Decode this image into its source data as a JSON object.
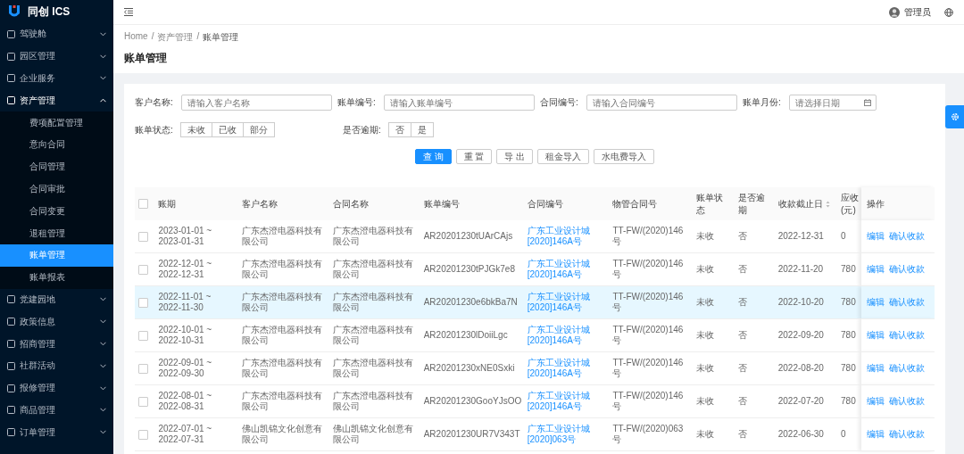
{
  "sidebar": {
    "logo": "同创 ICS",
    "items": [
      {
        "label": "驾驶舱",
        "expanded": false
      },
      {
        "label": "园区管理",
        "expanded": false
      },
      {
        "label": "企业服务",
        "expanded": false
      },
      {
        "label": "资产管理",
        "expanded": true,
        "children": [
          {
            "label": "费项配置管理",
            "selected": false
          },
          {
            "label": "意向合同",
            "selected": false
          },
          {
            "label": "合同管理",
            "selected": false
          },
          {
            "label": "合同审批",
            "selected": false
          },
          {
            "label": "合同变更",
            "selected": false
          },
          {
            "label": "退租管理",
            "selected": false
          },
          {
            "label": "账单管理",
            "selected": true
          },
          {
            "label": "账单报表",
            "selected": false
          }
        ]
      },
      {
        "label": "党建园地",
        "expanded": false
      },
      {
        "label": "政策信息",
        "expanded": false
      },
      {
        "label": "招商管理",
        "expanded": false
      },
      {
        "label": "社群活动",
        "expanded": false
      },
      {
        "label": "报修管理",
        "expanded": false
      },
      {
        "label": "商品管理",
        "expanded": false
      },
      {
        "label": "订单管理",
        "expanded": false
      }
    ]
  },
  "header": {
    "user": "管理员"
  },
  "breadcrumb": {
    "separator": "/",
    "items": [
      "Home",
      "资产管理",
      "账单管理"
    ]
  },
  "page_title": "账单管理",
  "filters": {
    "fields": [
      {
        "label": "客户名称:",
        "placeholder": "请输入客户名称",
        "kind": "text"
      },
      {
        "label": "账单编号:",
        "placeholder": "请输入账单编号",
        "kind": "text"
      },
      {
        "label": "合同编号:",
        "placeholder": "请输入合同编号",
        "kind": "text"
      },
      {
        "label": "账单月份:",
        "placeholder": "请选择日期",
        "kind": "date"
      }
    ],
    "groups": [
      {
        "label": "账单状态:",
        "options": [
          {
            "label": "未收",
            "selected": false
          },
          {
            "label": "已收",
            "selected": false
          },
          {
            "label": "部分",
            "selected": false
          }
        ]
      },
      {
        "label": "是否逾期:",
        "options": [
          {
            "label": "否",
            "selected": false
          },
          {
            "label": "是",
            "selected": false
          }
        ]
      }
    ],
    "buttons": [
      {
        "label": "查 询",
        "kind": "primary"
      },
      {
        "label": "重 置",
        "kind": "default"
      },
      {
        "label": "导 出",
        "kind": "default"
      },
      {
        "label": "租金导入",
        "kind": "default"
      },
      {
        "label": "水电费导入",
        "kind": "default"
      }
    ]
  },
  "table": {
    "all_checked": false,
    "columns": [
      "账期",
      "客户名称",
      "合同名称",
      "账单编号",
      "合同编号",
      "物管合同号",
      "账单状态",
      "是否逾期",
      "收款截止日",
      "应收(元)",
      "操作"
    ],
    "rows": [
      {
        "checked": false,
        "hovered": false,
        "cells": [
          "2023-01-01 ~ 2023-01-31",
          "广东杰澄电器科技有限公司",
          "广东杰澄电器科技有限公司",
          "AR20201230tUArCAjs",
          "广东工业设计城[2020]146A号",
          "TT-FW/(2020)146号",
          "未收",
          "否",
          "2022-12-31",
          "0"
        ],
        "actions": [
          "编辑",
          "确认收款"
        ]
      },
      {
        "checked": false,
        "hovered": false,
        "cells": [
          "2022-12-01 ~ 2022-12-31",
          "广东杰澄电器科技有限公司",
          "广东杰澄电器科技有限公司",
          "AR20201230tPJGk7e8",
          "广东工业设计城[2020]146A号",
          "TT-FW/(2020)146号",
          "未收",
          "否",
          "2022-11-20",
          "780"
        ],
        "actions": [
          "编辑",
          "确认收款"
        ]
      },
      {
        "checked": false,
        "hovered": true,
        "cells": [
          "2022-11-01 ~ 2022-11-30",
          "广东杰澄电器科技有限公司",
          "广东杰澄电器科技有限公司",
          "AR20201230e6bkBa7N",
          "广东工业设计城[2020]146A号",
          "TT-FW/(2020)146号",
          "未收",
          "否",
          "2022-10-20",
          "780"
        ],
        "actions": [
          "编辑",
          "确认收款"
        ]
      },
      {
        "checked": false,
        "hovered": false,
        "cells": [
          "2022-10-01 ~ 2022-10-31",
          "广东杰澄电器科技有限公司",
          "广东杰澄电器科技有限公司",
          "AR20201230lDoiiLgc",
          "广东工业设计城[2020]146A号",
          "TT-FW/(2020)146号",
          "未收",
          "否",
          "2022-09-20",
          "780"
        ],
        "actions": [
          "编辑",
          "确认收款"
        ]
      },
      {
        "checked": false,
        "hovered": false,
        "cells": [
          "2022-09-01 ~ 2022-09-30",
          "广东杰澄电器科技有限公司",
          "广东杰澄电器科技有限公司",
          "AR20201230xNE0Sxki",
          "广东工业设计城[2020]146A号",
          "TT-FW/(2020)146号",
          "未收",
          "否",
          "2022-08-20",
          "780"
        ],
        "actions": [
          "编辑",
          "确认收款"
        ]
      },
      {
        "checked": false,
        "hovered": false,
        "cells": [
          "2022-08-01 ~ 2022-08-31",
          "广东杰澄电器科技有限公司",
          "广东杰澄电器科技有限公司",
          "AR20201230GooYJsOO",
          "广东工业设计城[2020]146A号",
          "TT-FW/(2020)146号",
          "未收",
          "否",
          "2022-07-20",
          "780"
        ],
        "actions": [
          "编辑",
          "确认收款"
        ]
      },
      {
        "checked": false,
        "hovered": false,
        "cells": [
          "2022-07-01 ~ 2022-07-31",
          "佛山凯锦文化创意有限公司",
          "佛山凯锦文化创意有限公司",
          "AR20201230UR7V343T",
          "广东工业设计城[2020]063号",
          "TT-FW/(2020)063号",
          "未收",
          "否",
          "2022-06-30",
          "0"
        ],
        "actions": [
          "编辑",
          "确认收款"
        ]
      }
    ]
  }
}
